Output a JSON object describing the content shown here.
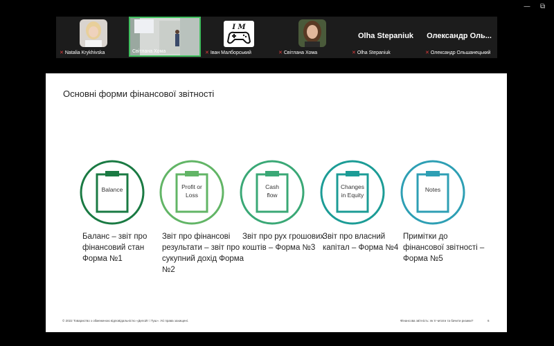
{
  "window": {
    "minimize_glyph": "—",
    "restore_glyph": "⧉"
  },
  "participants": [
    {
      "name": "Natalia Krykhivska",
      "muted": true,
      "display": "photo"
    },
    {
      "name": "Світлана Хома",
      "muted": false,
      "display": "video",
      "active_speaker": true
    },
    {
      "name": "Іван Малборський",
      "muted": true,
      "display": "logo",
      "logo_text": "I M"
    },
    {
      "name": "Світлана Хома",
      "muted": true,
      "display": "photo"
    },
    {
      "name": "Olha Stepaniuk",
      "muted": true,
      "display": "name",
      "big_name": "Olha Stepaniuk"
    },
    {
      "name": "Олександр Ольшанецький",
      "muted": true,
      "display": "name",
      "big_name": "Олександр Оль..."
    }
  ],
  "mute_icon": "muted-mic-icon",
  "slide": {
    "title": "Основні форми фінансової звітності",
    "forms": [
      {
        "icon_label_1": "Balance",
        "icon_label_2": "",
        "color": "#1a7a43",
        "caption": "Баланс – звіт про фінансовий стан Форма №1"
      },
      {
        "icon_label_1": "Profit or",
        "icon_label_2": "Loss",
        "color": "#62b566",
        "caption": "Звіт про фінансові результати – звіт про сукупний дохід Форма №2"
      },
      {
        "icon_label_1": "Cash",
        "icon_label_2": "flow",
        "color": "#3aa876",
        "caption": "Звіт про рух грошових коштів – Форма №3"
      },
      {
        "icon_label_1": "Changes",
        "icon_label_2": "in Equity",
        "color": "#1c9c96",
        "caption": "Звіт про власний капітал – Форма №4"
      },
      {
        "icon_label_1": "Notes",
        "icon_label_2": "",
        "color": "#2e9fb4",
        "caption": "Примітки до фінансової звітності – Форма №5"
      }
    ],
    "footer_left": "© 2022 Товариство з обмеженою відповідальністю «Делойт і Туш». Усі права захищені.",
    "footer_right": "Фінансова звітність: як її читати та бачити ризики?",
    "page_number": "6"
  }
}
